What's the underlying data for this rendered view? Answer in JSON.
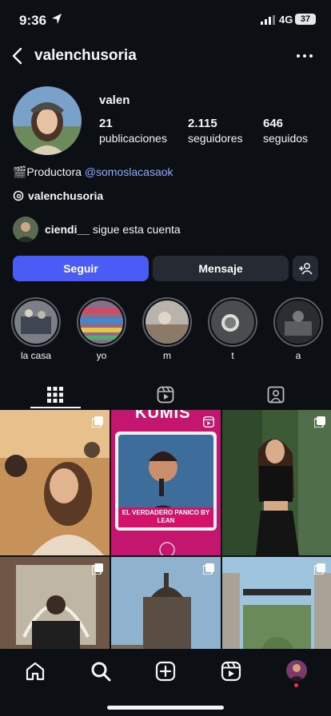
{
  "status_bar": {
    "time": "9:36",
    "network": "4G",
    "battery": "37"
  },
  "header": {
    "username": "valenchusoria"
  },
  "profile": {
    "name": "valen",
    "stats": [
      {
        "value": "21",
        "label": "publicaciones"
      },
      {
        "value": "2.115",
        "label": "seguidores"
      },
      {
        "value": "646",
        "label": "seguidos"
      }
    ],
    "bio_text": "🎬Productora ",
    "bio_link": "@somoslacasaok",
    "threads_handle": "valenchusoria",
    "followed_by_user": "ciendi__",
    "followed_by_suffix": " sigue esta cuenta"
  },
  "actions": {
    "follow": "Seguir",
    "message": "Mensaje"
  },
  "highlights": [
    {
      "label": "la casa"
    },
    {
      "label": "yo"
    },
    {
      "label": "m"
    },
    {
      "label": "t"
    },
    {
      "label": "a"
    }
  ],
  "posts": [
    {
      "overlay_title": "",
      "caption": ""
    },
    {
      "overlay_title": "KUMIS",
      "caption": "EL VERDADERO PANICO BY LEAN"
    },
    {
      "overlay_title": "",
      "caption": ""
    }
  ],
  "colors": {
    "accent": "#4a5cf5",
    "background": "#0c1014",
    "link": "#8ea7ff"
  },
  "nav": {
    "items": [
      "home-icon",
      "search-icon",
      "create-icon",
      "reels-icon",
      "profile-avatar"
    ]
  }
}
